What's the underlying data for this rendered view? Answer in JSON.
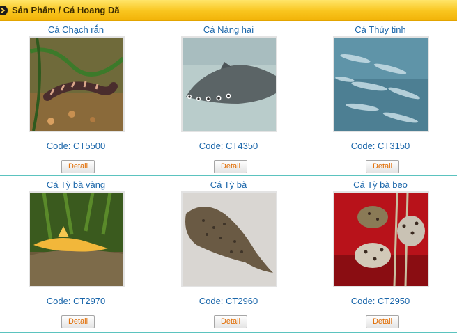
{
  "header": {
    "breadcrumb": "Sản Phẩm / Cá Hoang Dã"
  },
  "products": [
    {
      "name": "Cá Chạch rắn",
      "code": "Code: CT5500",
      "detail_label": "Detail"
    },
    {
      "name": "Cá Nàng hai",
      "code": "Code: CT4350",
      "detail_label": "Detail"
    },
    {
      "name": "Cá Thủy tinh",
      "code": "Code: CT3150",
      "detail_label": "Detail"
    },
    {
      "name": "Cá Tỳ bà vàng",
      "code": "Code: CT2970",
      "detail_label": "Detail"
    },
    {
      "name": "Cá Tỳ bà",
      "code": "Code: CT2960",
      "detail_label": "Detail"
    },
    {
      "name": "Cá Tỳ bà beo",
      "code": "Code: CT2950",
      "detail_label": "Detail"
    }
  ],
  "colors": {
    "header_bg": "#f9c51e",
    "link_blue": "#1a66aa",
    "detail_orange": "#e06b00",
    "row_divider": "#5bc3bf"
  }
}
